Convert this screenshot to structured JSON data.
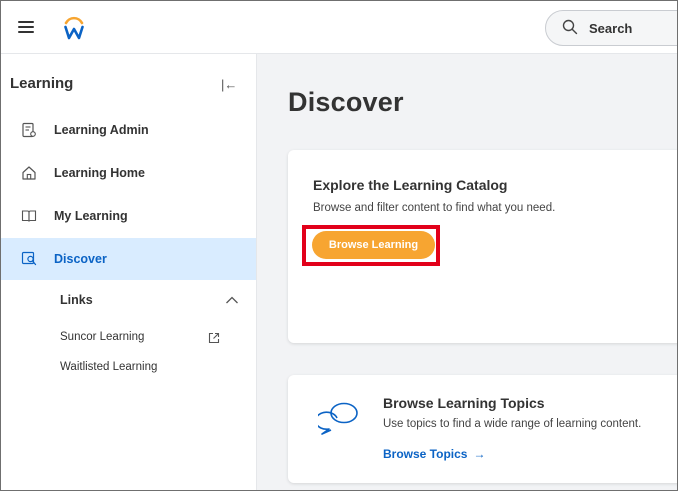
{
  "header": {
    "search_label": "Search",
    "icons": [
      "menu-icon",
      "workday-logo",
      "search-icon"
    ],
    "brand_colors": {
      "blue": "#0b63c5",
      "orange": "#f7a531"
    }
  },
  "sidebar": {
    "title": "Learning",
    "nav": [
      {
        "label": "Learning Admin",
        "icon": "admin-report-icon"
      },
      {
        "label": "Learning Home",
        "icon": "home-icon"
      },
      {
        "label": "My Learning",
        "icon": "book-icon"
      },
      {
        "label": "Discover",
        "icon": "discover-icon",
        "active": true
      }
    ],
    "links_header": "Links",
    "links": [
      {
        "label": "Suncor Learning",
        "external": true
      },
      {
        "label": "Waitlisted Learning"
      }
    ]
  },
  "main": {
    "title": "Discover",
    "catalog_card": {
      "title": "Explore the Learning Catalog",
      "description": "Browse and filter content to find what you need.",
      "button": "Browse Learning"
    },
    "topics_card": {
      "title": "Browse Learning Topics",
      "description": "Use topics to find a wide range of learning content.",
      "link": "Browse Topics",
      "link_arrow": "→"
    }
  }
}
